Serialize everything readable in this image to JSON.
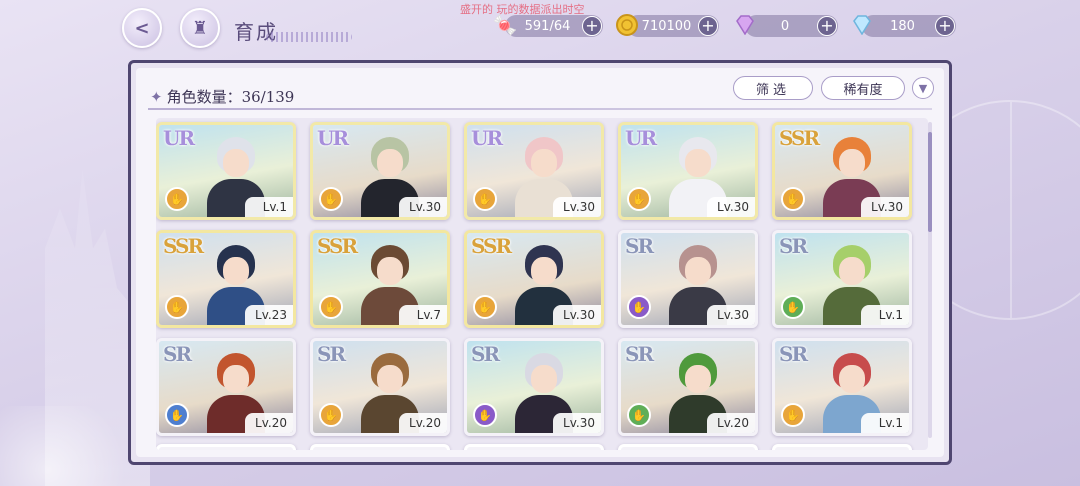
{
  "header": {
    "back_icon": "back-arrow-icon",
    "home_icon": "castle-home-icon",
    "title": "育成",
    "watermark": "盛开的 玩的数据派出时空"
  },
  "currencies": [
    {
      "name": "candy",
      "icon": "candy-icon",
      "value": "591/64"
    },
    {
      "name": "coin",
      "icon": "gold-coin-icon",
      "value": "710100"
    },
    {
      "name": "pink-gem",
      "icon": "pink-diamond-icon",
      "value": "0"
    },
    {
      "name": "blue-gem",
      "icon": "blue-diamond-icon",
      "value": "180"
    }
  ],
  "panel": {
    "count_label": "角色数量：36/139",
    "filter_label": "筛选",
    "rarity_label": "稀有度",
    "sort_icon": "sort-toggle-icon"
  },
  "cards": [
    {
      "rarity": "UR",
      "level": "Lv.1",
      "element": "orange"
    },
    {
      "rarity": "UR",
      "level": "Lv.30",
      "element": "orange"
    },
    {
      "rarity": "UR",
      "level": "Lv.30",
      "element": "orange"
    },
    {
      "rarity": "UR",
      "level": "Lv.30",
      "element": "orange"
    },
    {
      "rarity": "SSR",
      "level": "Lv.30",
      "element": "orange"
    },
    {
      "rarity": "SSR",
      "level": "Lv.23",
      "element": "orange"
    },
    {
      "rarity": "SSR",
      "level": "Lv.7",
      "element": "orange"
    },
    {
      "rarity": "SSR",
      "level": "Lv.30",
      "element": "orange"
    },
    {
      "rarity": "SR",
      "level": "Lv.30",
      "element": "purple"
    },
    {
      "rarity": "SR",
      "level": "Lv.1",
      "element": "green"
    },
    {
      "rarity": "SR",
      "level": "Lv.20",
      "element": "blue"
    },
    {
      "rarity": "SR",
      "level": "Lv.20",
      "element": "orange"
    },
    {
      "rarity": "SR",
      "level": "Lv.30",
      "element": "purple"
    },
    {
      "rarity": "SR",
      "level": "Lv.20",
      "element": "green"
    },
    {
      "rarity": "SR",
      "level": "Lv.1",
      "element": "orange"
    }
  ]
}
